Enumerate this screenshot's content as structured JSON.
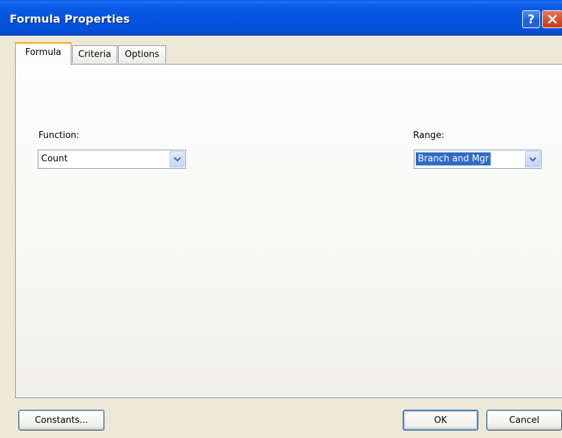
{
  "window": {
    "title": "Formula Properties"
  },
  "titlebar": {
    "help_glyph": "?",
    "help_icon": "help-icon",
    "close_icon": "close-icon"
  },
  "tabs": [
    {
      "label": "Formula",
      "active": true
    },
    {
      "label": "Criteria",
      "active": false
    },
    {
      "label": "Options",
      "active": false
    }
  ],
  "formula": {
    "function": {
      "label": "Function:",
      "value": "Count"
    },
    "range": {
      "label": "Range:",
      "value": "Branch and Mgr"
    }
  },
  "buttons": {
    "constants": "Constants...",
    "ok": "OK",
    "cancel": "Cancel"
  },
  "colors": {
    "titlebar": "#0553e0",
    "selection": "#316ac5",
    "tab_highlight": "#f8b84a",
    "dialog_bg": "#ece9d8"
  }
}
